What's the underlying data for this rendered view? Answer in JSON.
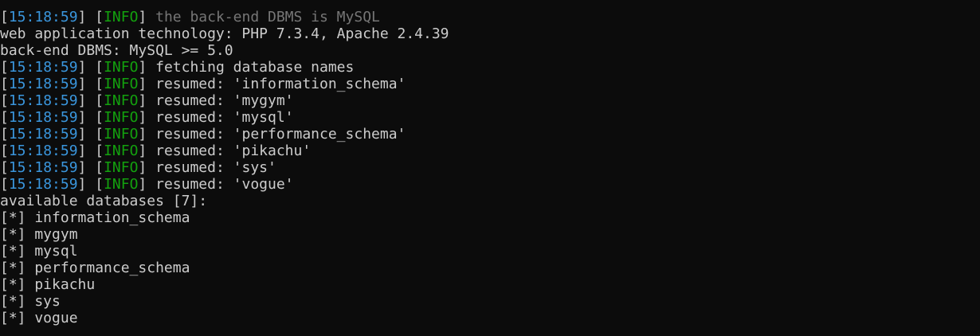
{
  "colors": {
    "background": "#0c0c0c",
    "text": "#cccccc",
    "timestamp": "#3a96dd",
    "info_level": "#13a10e",
    "dim_text": "#767676"
  },
  "terminal": {
    "lines": [
      {
        "type": "log",
        "time": "15:18:59",
        "level": "INFO",
        "message": "the back-end DBMS is MySQL",
        "dim": true
      },
      {
        "type": "plain",
        "text": "web application technology: PHP 7.3.4, Apache 2.4.39"
      },
      {
        "type": "plain",
        "text": "back-end DBMS: MySQL >= 5.0"
      },
      {
        "type": "log",
        "time": "15:18:59",
        "level": "INFO",
        "message": "fetching database names"
      },
      {
        "type": "log",
        "time": "15:18:59",
        "level": "INFO",
        "message": "resumed: 'information_schema'"
      },
      {
        "type": "log",
        "time": "15:18:59",
        "level": "INFO",
        "message": "resumed: 'mygym'"
      },
      {
        "type": "log",
        "time": "15:18:59",
        "level": "INFO",
        "message": "resumed: 'mysql'"
      },
      {
        "type": "log",
        "time": "15:18:59",
        "level": "INFO",
        "message": "resumed: 'performance_schema'"
      },
      {
        "type": "log",
        "time": "15:18:59",
        "level": "INFO",
        "message": "resumed: 'pikachu'"
      },
      {
        "type": "log",
        "time": "15:18:59",
        "level": "INFO",
        "message": "resumed: 'sys'"
      },
      {
        "type": "log",
        "time": "15:18:59",
        "level": "INFO",
        "message": "resumed: 'vogue'"
      },
      {
        "type": "plain",
        "text": "available databases [7]:"
      },
      {
        "type": "plain",
        "text": "[*] information_schema"
      },
      {
        "type": "plain",
        "text": "[*] mygym"
      },
      {
        "type": "plain",
        "text": "[*] mysql"
      },
      {
        "type": "plain",
        "text": "[*] performance_schema"
      },
      {
        "type": "plain",
        "text": "[*] pikachu"
      },
      {
        "type": "plain",
        "text": "[*] sys"
      },
      {
        "type": "plain",
        "text": "[*] vogue"
      }
    ]
  }
}
